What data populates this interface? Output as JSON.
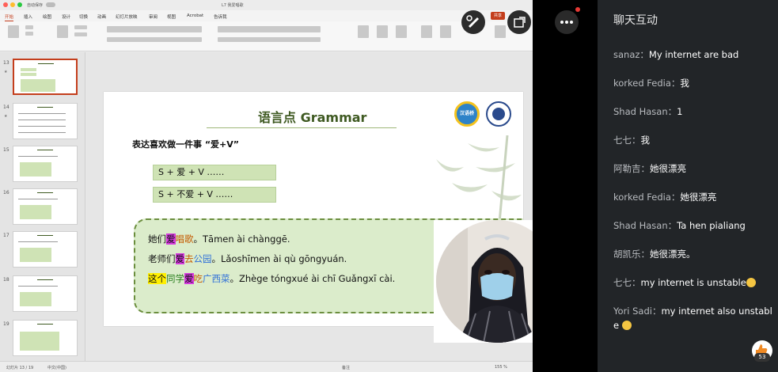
{
  "ppt": {
    "autosave_label": "自动保存",
    "doc_title": "L7 我爱唱歌",
    "menu": [
      "开始",
      "插入",
      "绘图",
      "设计",
      "切换",
      "动画",
      "幻灯片放映",
      "审阅",
      "视图",
      "Acrobat",
      "告诉我"
    ],
    "share_label": "共享",
    "thumb_numbers": [
      "13",
      "14",
      "15",
      "16",
      "17",
      "18",
      "19"
    ],
    "status_left": "幻灯片 13 / 19",
    "status_lang": "中文(中国)",
    "status_notes": "备注",
    "status_zoom": "155 %"
  },
  "slide": {
    "title": "语言点 Grammar",
    "logo_text": "汉语桥",
    "subtitle": "表达喜欢做一件事 “爱+V”",
    "pattern1": "S + 爱 + V ……",
    "pattern2": "S + 不爱 + V ……",
    "ex1": {
      "a": "她们",
      "b": "爱",
      "c": "唱歌",
      "d": "。Tāmen ài chànggē."
    },
    "ex2": {
      "a": "老师们",
      "b": "爱",
      "c": "去",
      "d": "公园",
      "e": "。Lǎoshīmen ài qù gōngyuán."
    },
    "ex3": {
      "a": "这个",
      "b": "同学",
      "c": "爱",
      "d": "吃",
      "e": "广西菜",
      "f": "。Zhège tóngxué ài chī Guǎngxī cài."
    }
  },
  "chat": {
    "title": "聊天互动",
    "messages": [
      {
        "name": "sanaz",
        "text": "My internet are bad"
      },
      {
        "name": "korked Fedia",
        "text": "我"
      },
      {
        "name": "Shad Hasan",
        "text": "1"
      },
      {
        "name": "七七",
        "text": "我"
      },
      {
        "name": "阿勒吉",
        "text": "她很漂亮"
      },
      {
        "name": "korked Fedia",
        "text": "她很漂亮"
      },
      {
        "name": "Shad Hasan",
        "text": "Ta hen pialiang"
      },
      {
        "name": "胡凯乐",
        "text": "她很漂亮。"
      },
      {
        "name": "七七",
        "text": "my internet is unstable"
      },
      {
        "name": "Yori Sadi",
        "text": "my internet also unstable"
      }
    ],
    "separator": "：",
    "like_count": "53"
  },
  "colors": {
    "accent": "#c43e1c",
    "chat_bg": "#222528",
    "slide_green": "#cfe3b5",
    "highlight_magenta": "#d63adf",
    "highlight_yellow": "#ffef00"
  }
}
